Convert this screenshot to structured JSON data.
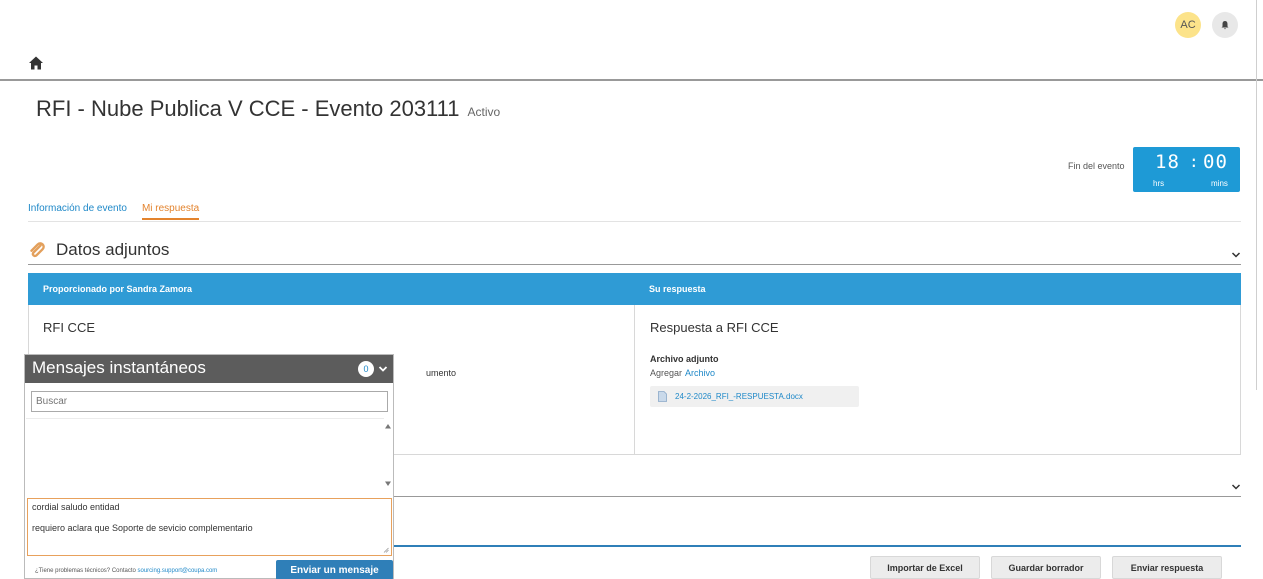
{
  "user": {
    "initials": "AC"
  },
  "event": {
    "title": "RFI - Nube Publica V CCE - Evento 203111",
    "status": "Activo"
  },
  "timer": {
    "label": "Fin del evento",
    "hours": "18",
    "minutes": "00",
    "hours_unit": "hrs",
    "minutes_unit": "mins"
  },
  "tabs": [
    {
      "label": "Información de evento",
      "active": false
    },
    {
      "label": "Mi respuesta",
      "active": true
    }
  ],
  "attachments": {
    "title": "Datos adjuntos",
    "col_left": "Proporcionado por Sandra Zamora",
    "col_right": "Su respuesta",
    "left_title": "RFI CCE",
    "left_partial_text": "umento",
    "right_title": "Respuesta a RFI CCE",
    "right_subtitle": "Archivo adjunto",
    "add_label": "Agregar",
    "add_link": "Archivo",
    "file_name": "24-2-2026_RFI_-RESPUESTA.docx"
  },
  "buttons": {
    "import": "Importar de Excel",
    "save_draft": "Guardar borrador",
    "submit": "Enviar respuesta"
  },
  "chat": {
    "title": "Mensajes instantáneos",
    "count": "0",
    "search_placeholder": "Buscar",
    "message_line1": "cordial saludo entidad",
    "message_line2": "requiero aclara que Soporte de sevicio complementario",
    "footer_text": "¿Tiene problemas técnicos? Contacto",
    "footer_email": "sourcing.support@coupa.com",
    "send_label": "Enviar un mensaje"
  },
  "colors": {
    "accent": "#1e9ad6",
    "header_blue": "#2f9bd5",
    "active_tab": "#e3832d",
    "avatar": "#fce38a"
  }
}
